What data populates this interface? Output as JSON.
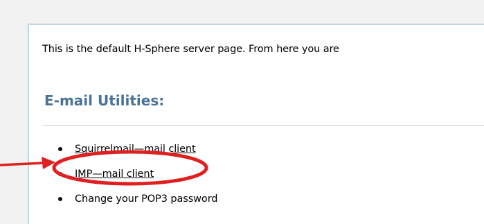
{
  "intro_text": "This is the default H-Sphere server page. From here you are",
  "email_heading": "E-mail Utilities:",
  "links": [
    {
      "label": "Squirrelmail—mail client"
    },
    {
      "label": "IMP—mail client"
    },
    {
      "label": "Change your POP3 password"
    }
  ],
  "colors": {
    "heading": "#4c7396",
    "annotation": "#e02020",
    "panel_border": "#c5d5e6"
  }
}
